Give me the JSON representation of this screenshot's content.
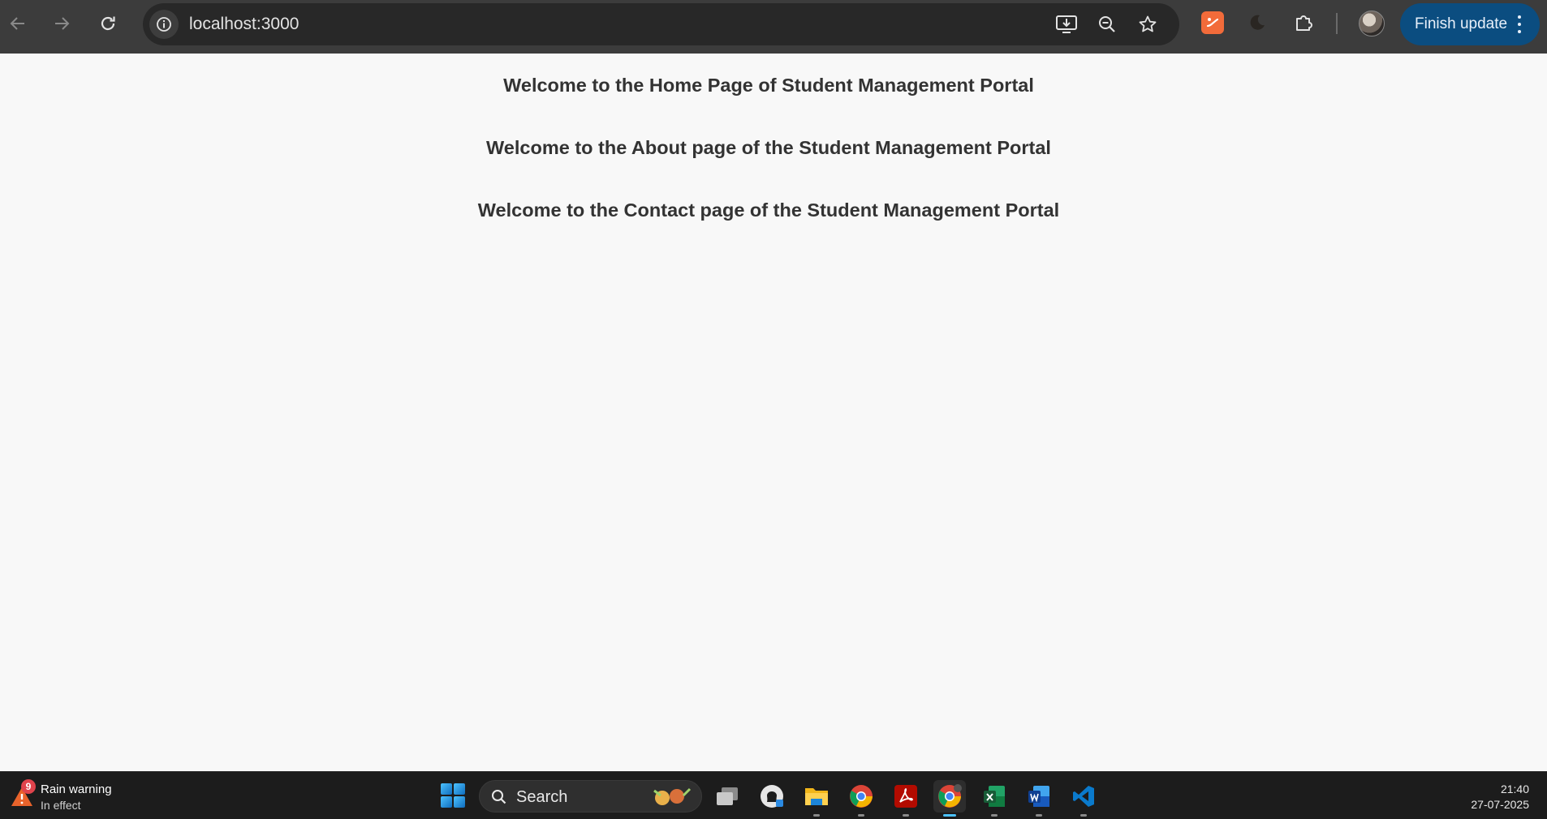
{
  "browser": {
    "url": "localhost:3000",
    "finish_update_label": "Finish update"
  },
  "page": {
    "headings": [
      "Welcome to the Home Page of Student Management Portal",
      "Welcome to the About page of the Student Management Portal",
      "Welcome to the Contact page of the Student Management Portal"
    ]
  },
  "taskbar": {
    "weather": {
      "badge": "9",
      "title": "Rain warning",
      "subtitle": "In effect"
    },
    "search_label": "Search",
    "pinned_apps": [
      "task-view",
      "github-desktop",
      "file-explorer",
      "chrome",
      "acrobat",
      "chrome-profile",
      "excel",
      "word",
      "vscode"
    ],
    "clock": {
      "time": "21:40",
      "date": "27-07-2025"
    }
  },
  "colors": {
    "toolbar_bg": "#3c3c3c",
    "omnibox_bg": "#282828",
    "finish_update_bg": "#0b4d80",
    "page_bg": "#f8f8f8",
    "heading_text": "#333333",
    "taskbar_bg": "#1c1c1c"
  }
}
